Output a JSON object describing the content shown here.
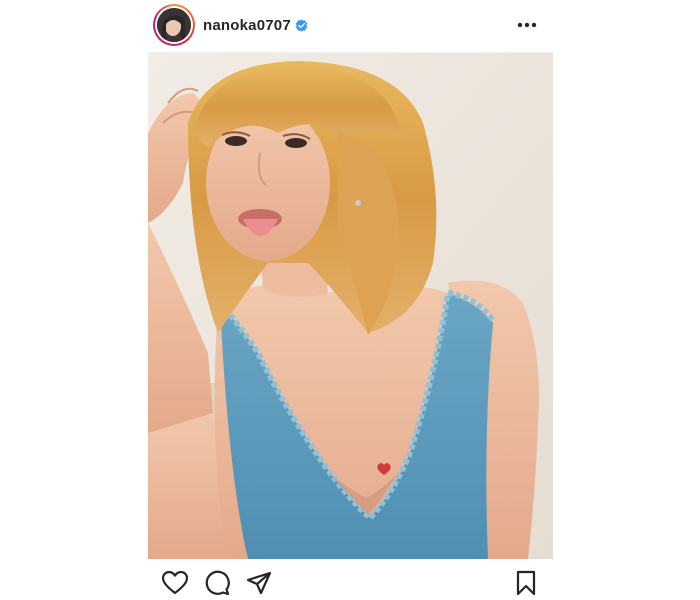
{
  "post": {
    "username": "nanoka0707",
    "verified": true
  },
  "icons": {
    "avatar": "profile-avatar",
    "verified": "verified-badge-icon",
    "more": "more-options-icon",
    "like": "heart-icon",
    "comment": "comment-icon",
    "share": "send-icon",
    "save": "bookmark-icon"
  },
  "colors": {
    "text": "#262626",
    "verified": "#3897f0",
    "border": "#efefef"
  }
}
